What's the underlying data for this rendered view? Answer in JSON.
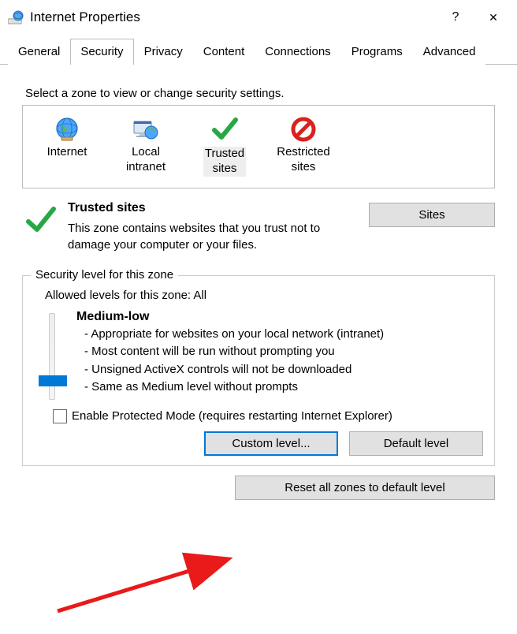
{
  "window": {
    "title": "Internet Properties",
    "help": "?",
    "close": "✕"
  },
  "tabs": [
    "General",
    "Security",
    "Privacy",
    "Content",
    "Connections",
    "Programs",
    "Advanced"
  ],
  "active_tab": "Security",
  "zone_prompt": "Select a zone to view or change security settings.",
  "zones": [
    {
      "label": "Internet",
      "icon": "globe"
    },
    {
      "label": "Local\nintranet",
      "icon": "monitor"
    },
    {
      "label": "Trusted\nsites",
      "icon": "check"
    },
    {
      "label": "Restricted\nsites",
      "icon": "forbid"
    }
  ],
  "selected_zone_index": 2,
  "zone_detail": {
    "title": "Trusted sites",
    "desc": "This zone contains websites that you trust not to damage your computer or your files.",
    "sites_btn": "Sites"
  },
  "group": {
    "legend": "Security level for this zone",
    "allowed": "Allowed levels for this zone: All",
    "level_name": "Medium-low",
    "bullets": [
      "- Appropriate for websites on your local network (intranet)",
      "- Most content will be run without prompting you",
      "- Unsigned ActiveX controls will not be downloaded",
      "- Same as Medium level without prompts"
    ],
    "checkbox": "Enable Protected Mode (requires restarting Internet Explorer)",
    "custom_level": "Custom level...",
    "default_level": "Default level"
  },
  "reset_btn": "Reset all zones to default level"
}
